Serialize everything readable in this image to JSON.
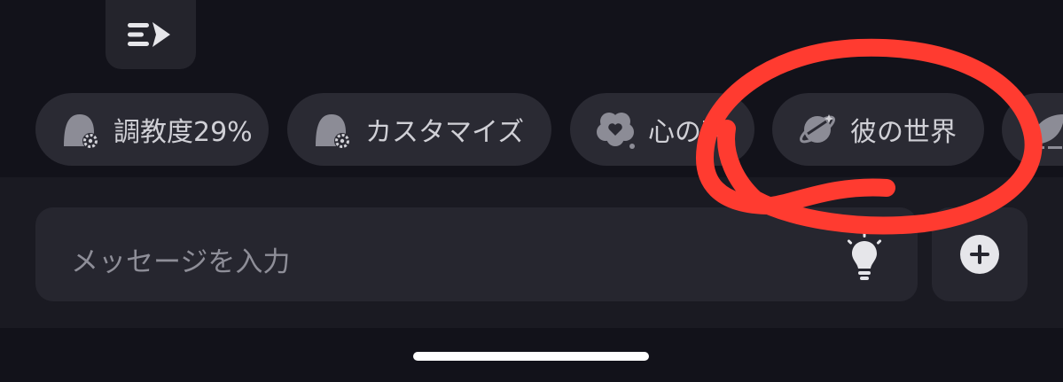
{
  "toolbar": {
    "fast_icon": "fast-forward-dash-icon"
  },
  "chips": [
    {
      "label": "調教度29%",
      "icon": "character-gear-icon"
    },
    {
      "label": "カスタマイズ",
      "icon": "character-gear-icon"
    },
    {
      "label": "心の声",
      "icon": "heart-flower-icon"
    },
    {
      "label": "彼の世界",
      "icon": "planet-icon"
    },
    {
      "label": "",
      "icon": "leaf-icon"
    }
  ],
  "composer": {
    "placeholder": "メッセージを入力",
    "hint_icon": "lightbulb-icon",
    "add_icon": "plus-circle-icon"
  },
  "colors": {
    "background": "#12121a",
    "panel": "#1a1a22",
    "chip": "#2a2a33",
    "annotation": "#ff3b30"
  }
}
